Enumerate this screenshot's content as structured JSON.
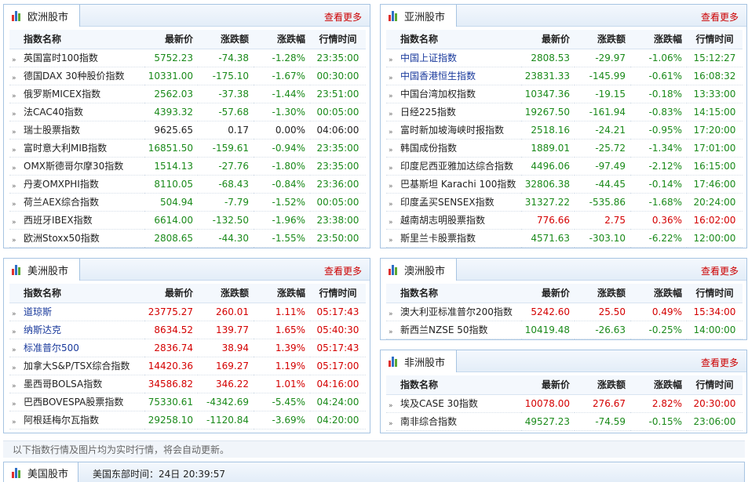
{
  "common": {
    "more_label": "查看更多",
    "columns": [
      "指数名称",
      "最新价",
      "涨跌额",
      "涨跌幅",
      "行情时间"
    ]
  },
  "europe": {
    "title": "欧洲股市",
    "rows": [
      {
        "name": "英国富时100指数",
        "price": "5752.23",
        "change": "-74.38",
        "pct": "-1.28%",
        "time": "23:35:00",
        "color": "green"
      },
      {
        "name": "德国DAX 30种股价指数",
        "price": "10331.00",
        "change": "-175.10",
        "pct": "-1.67%",
        "time": "00:30:00",
        "color": "green"
      },
      {
        "name": "俄罗斯MICEX指数",
        "price": "2562.03",
        "change": "-37.38",
        "pct": "-1.44%",
        "time": "23:51:00",
        "color": "green"
      },
      {
        "name": "法CAC40指数",
        "price": "4393.32",
        "change": "-57.68",
        "pct": "-1.30%",
        "time": "00:05:00",
        "color": "green"
      },
      {
        "name": "瑞士股票指数",
        "price": "9625.65",
        "change": "0.17",
        "pct": "0.00%",
        "time": "04:06:00",
        "color": "dark"
      },
      {
        "name": "富时意大利MIB指数",
        "price": "16851.50",
        "change": "-159.61",
        "pct": "-0.94%",
        "time": "23:35:00",
        "color": "green"
      },
      {
        "name": "OMX斯德哥尔摩30指数",
        "price": "1514.13",
        "change": "-27.76",
        "pct": "-1.80%",
        "time": "23:35:00",
        "color": "green"
      },
      {
        "name": "丹麦OMXPHI指数",
        "price": "8110.05",
        "change": "-68.43",
        "pct": "-0.84%",
        "time": "23:36:00",
        "color": "green"
      },
      {
        "name": "荷兰AEX综合指数",
        "price": "504.94",
        "change": "-7.79",
        "pct": "-1.52%",
        "time": "00:05:00",
        "color": "green"
      },
      {
        "name": "西班牙IBEX指数",
        "price": "6614.00",
        "change": "-132.50",
        "pct": "-1.96%",
        "time": "23:38:00",
        "color": "green"
      },
      {
        "name": "欧洲Stoxx50指数",
        "price": "2808.65",
        "change": "-44.30",
        "pct": "-1.55%",
        "time": "23:50:00",
        "color": "green"
      }
    ]
  },
  "asia": {
    "title": "亚洲股市",
    "rows": [
      {
        "name": "中国上证指数",
        "price": "2808.53",
        "change": "-29.97",
        "pct": "-1.06%",
        "time": "15:12:27",
        "color": "green",
        "link": true
      },
      {
        "name": "中国香港恒生指数",
        "price": "23831.33",
        "change": "-145.99",
        "pct": "-0.61%",
        "time": "16:08:32",
        "color": "green",
        "link": true
      },
      {
        "name": "中国台湾加权指数",
        "price": "10347.36",
        "change": "-19.15",
        "pct": "-0.18%",
        "time": "13:33:00",
        "color": "green"
      },
      {
        "name": "日经225指数",
        "price": "19267.50",
        "change": "-161.94",
        "pct": "-0.83%",
        "time": "14:15:00",
        "color": "green"
      },
      {
        "name": "富时新加坡海峡时报指数",
        "price": "2518.16",
        "change": "-24.21",
        "pct": "-0.95%",
        "time": "17:20:00",
        "color": "green"
      },
      {
        "name": "韩国成份指数",
        "price": "1889.01",
        "change": "-25.72",
        "pct": "-1.34%",
        "time": "17:01:00",
        "color": "green"
      },
      {
        "name": "印度尼西亚雅加达综合指数",
        "price": "4496.06",
        "change": "-97.49",
        "pct": "-2.12%",
        "time": "16:15:00",
        "color": "green"
      },
      {
        "name": "巴基斯坦 Karachi 100指数",
        "price": "32806.38",
        "change": "-44.45",
        "pct": "-0.14%",
        "time": "17:46:00",
        "color": "green"
      },
      {
        "name": "印度孟买SENSEX指数",
        "price": "31327.22",
        "change": "-535.86",
        "pct": "-1.68%",
        "time": "20:24:00",
        "color": "green"
      },
      {
        "name": "越南胡志明股票指数",
        "price": "776.66",
        "change": "2.75",
        "pct": "0.36%",
        "time": "16:02:00",
        "color": "red"
      },
      {
        "name": "斯里兰卡股票指数",
        "price": "4571.63",
        "change": "-303.10",
        "pct": "-6.22%",
        "time": "12:00:00",
        "color": "green"
      }
    ]
  },
  "america": {
    "title": "美洲股市",
    "rows": [
      {
        "name": "道琼斯",
        "price": "23775.27",
        "change": "260.01",
        "pct": "1.11%",
        "time": "05:17:43",
        "color": "red",
        "link": true
      },
      {
        "name": "纳斯达克",
        "price": "8634.52",
        "change": "139.77",
        "pct": "1.65%",
        "time": "05:40:30",
        "color": "red",
        "link": true
      },
      {
        "name": "标准普尔500",
        "price": "2836.74",
        "change": "38.94",
        "pct": "1.39%",
        "time": "05:17:43",
        "color": "red",
        "link": true
      },
      {
        "name": "加拿大S&P/TSX综合指数",
        "price": "14420.36",
        "change": "169.27",
        "pct": "1.19%",
        "time": "05:17:00",
        "color": "red"
      },
      {
        "name": "墨西哥BOLSA指数",
        "price": "34586.82",
        "change": "346.22",
        "pct": "1.01%",
        "time": "04:16:00",
        "color": "red"
      },
      {
        "name": "巴西BOVESPA股票指数",
        "price": "75330.61",
        "change": "-4342.69",
        "pct": "-5.45%",
        "time": "04:24:00",
        "color": "green"
      },
      {
        "name": "阿根廷梅尔瓦指数",
        "price": "29258.10",
        "change": "-1120.84",
        "pct": "-3.69%",
        "time": "04:20:00",
        "color": "green"
      }
    ]
  },
  "oceania": {
    "title": "澳洲股市",
    "rows": [
      {
        "name": "澳大利亚标准普尔200指数",
        "price": "5242.60",
        "change": "25.50",
        "pct": "0.49%",
        "time": "15:34:00",
        "color": "red"
      },
      {
        "name": "新西兰NZSE 50指数",
        "price": "10419.48",
        "change": "-26.63",
        "pct": "-0.25%",
        "time": "14:00:00",
        "color": "green"
      }
    ]
  },
  "africa": {
    "title": "非洲股市",
    "rows": [
      {
        "name": "埃及CASE 30指数",
        "price": "10078.00",
        "change": "276.67",
        "pct": "2.82%",
        "time": "20:30:00",
        "color": "red"
      },
      {
        "name": "南非综合指数",
        "price": "49527.23",
        "change": "-74.59",
        "pct": "-0.15%",
        "time": "23:06:00",
        "color": "green"
      }
    ]
  },
  "footer": {
    "note": "以下指数行情及图片均为实时行情，将会自动更新。",
    "tab_title": "美国股市",
    "time_text": "美国东部时间：24日 20:39:57"
  }
}
